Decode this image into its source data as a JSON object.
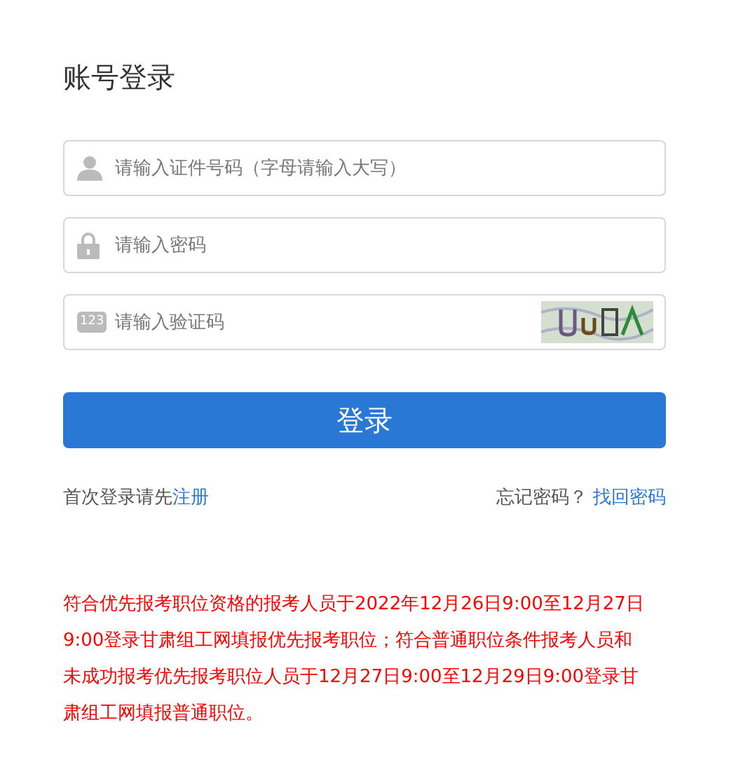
{
  "title": "账号登录",
  "fields": [
    {
      "kind": "user",
      "placeholder": "请输入证件号码（字母请输入大写）"
    },
    {
      "kind": "password",
      "placeholder": "请输入密码"
    },
    {
      "kind": "captcha",
      "badge": "123",
      "placeholder": "请输入验证码"
    }
  ],
  "login_button": "登录",
  "register": {
    "text": "首次登录请先",
    "link": "注册"
  },
  "forgot": {
    "text": "忘记密码？",
    "link": "找回密码"
  },
  "notice": "符合优先报考职位资格的报考人员于2022年12月26日9:00至12月27日9:00登录甘肃组工网填报优先报考职位；符合普通职位条件报考人员和未成功报考优先报考职位人员于12月27日9:00至12月29日9:00登录甘肃组工网填报普通职位。"
}
